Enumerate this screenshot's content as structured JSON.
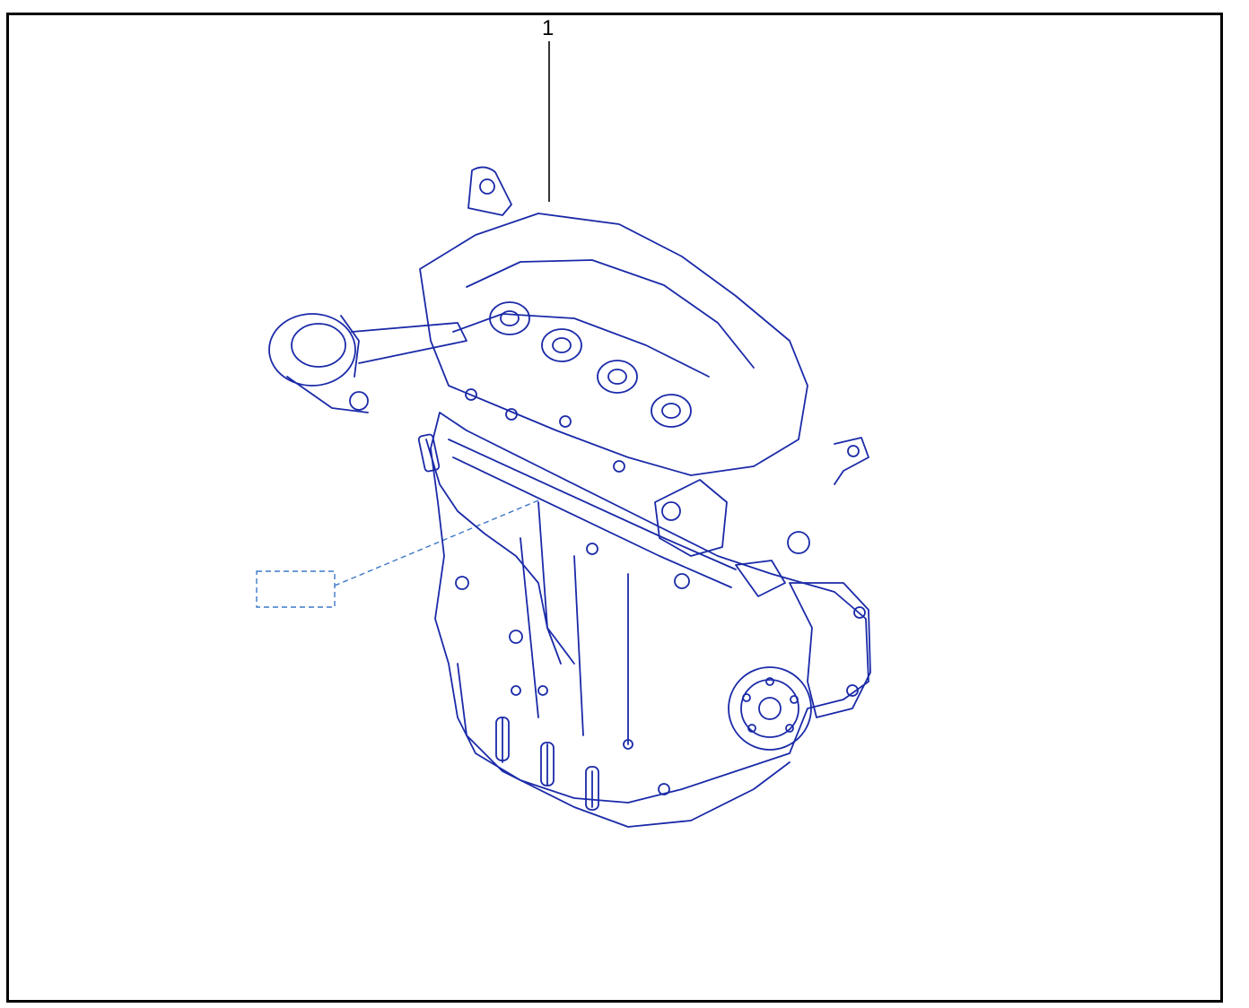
{
  "diagram": {
    "callouts": [
      {
        "label": "1"
      }
    ],
    "colors": {
      "line": "#1a2aa8",
      "frame": "#000000",
      "placeholder": "#3c78c8"
    },
    "subject_icon": "engine-assembly-illustration"
  }
}
